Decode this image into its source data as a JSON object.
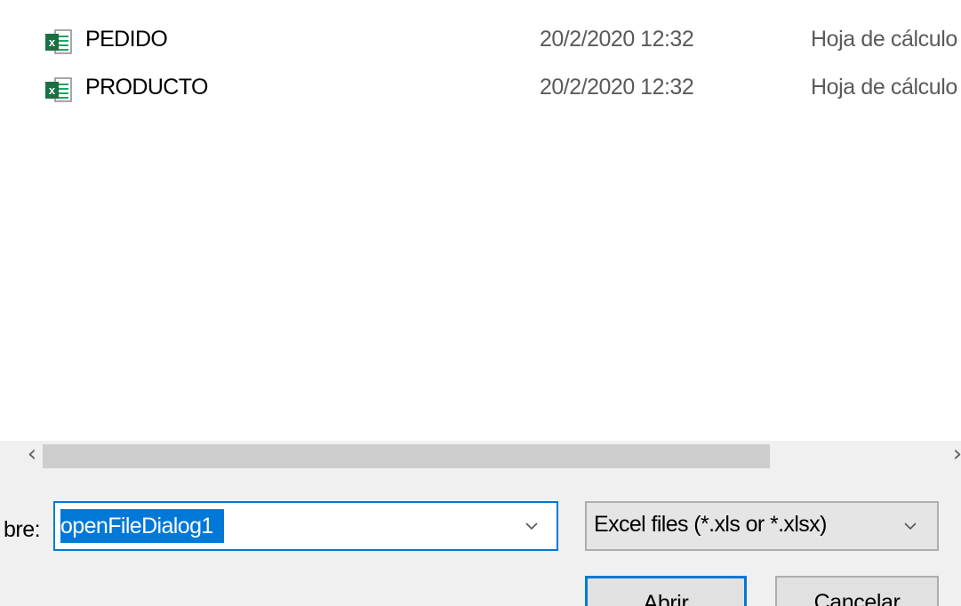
{
  "file_list": {
    "rows": [
      {
        "name": "PEDIDO",
        "date_modified": "20/2/2020 12:32",
        "type": "Hoja de cálculo",
        "icon": "excel-file-icon"
      },
      {
        "name": "PRODUCTO",
        "date_modified": "20/2/2020 12:32",
        "type": "Hoja de cálculo",
        "icon": "excel-file-icon"
      }
    ]
  },
  "scrollbar": {
    "left_arrow": "‹",
    "right_arrow": "›"
  },
  "filename": {
    "label": "bre:",
    "value": "openFileDialog1",
    "selected": true
  },
  "filetype": {
    "selected": "Excel files (*.xls or *.xlsx)"
  },
  "buttons": {
    "open_label": "Abrir",
    "cancel_label": "Cancelar"
  },
  "colors": {
    "accent": "#0078d7",
    "excel_green": "#1d6f42",
    "panel_bg": "#f0f0f0"
  }
}
